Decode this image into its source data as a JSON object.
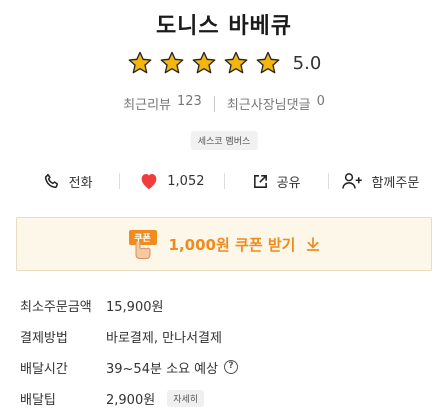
{
  "store": {
    "name": "도니스 바베큐",
    "rating": "5.0",
    "stars_filled": 5,
    "stars_total": 5,
    "recent_reviews_label": "최근리뷰",
    "recent_reviews_count": "123",
    "owner_replies_label": "최근사장님댓글",
    "owner_replies_count": "0",
    "badge": "세스코 멤버스"
  },
  "actions": {
    "call_label": "전화",
    "likes_count": "1,052",
    "share_label": "공유",
    "group_order_label": "함께주문"
  },
  "coupon": {
    "tag": "쿠폰",
    "text": "1,000원 쿠폰 받기"
  },
  "info": {
    "min_order_label": "최소주문금액",
    "min_order_value": "15,900원",
    "payment_label": "결제방법",
    "payment_value": "바로결제, 만나서결제",
    "delivery_time_label": "배달시간",
    "delivery_time_value": "39~54분 소요 예상",
    "delivery_tip_label": "배달팁",
    "delivery_tip_value": "2,900원",
    "detail_button": "자세히"
  },
  "colors": {
    "star": "#f5b50f",
    "heart": "#f03c3c",
    "coupon_accent": "#f08c1e",
    "coupon_bg": "#fdf7ea"
  }
}
